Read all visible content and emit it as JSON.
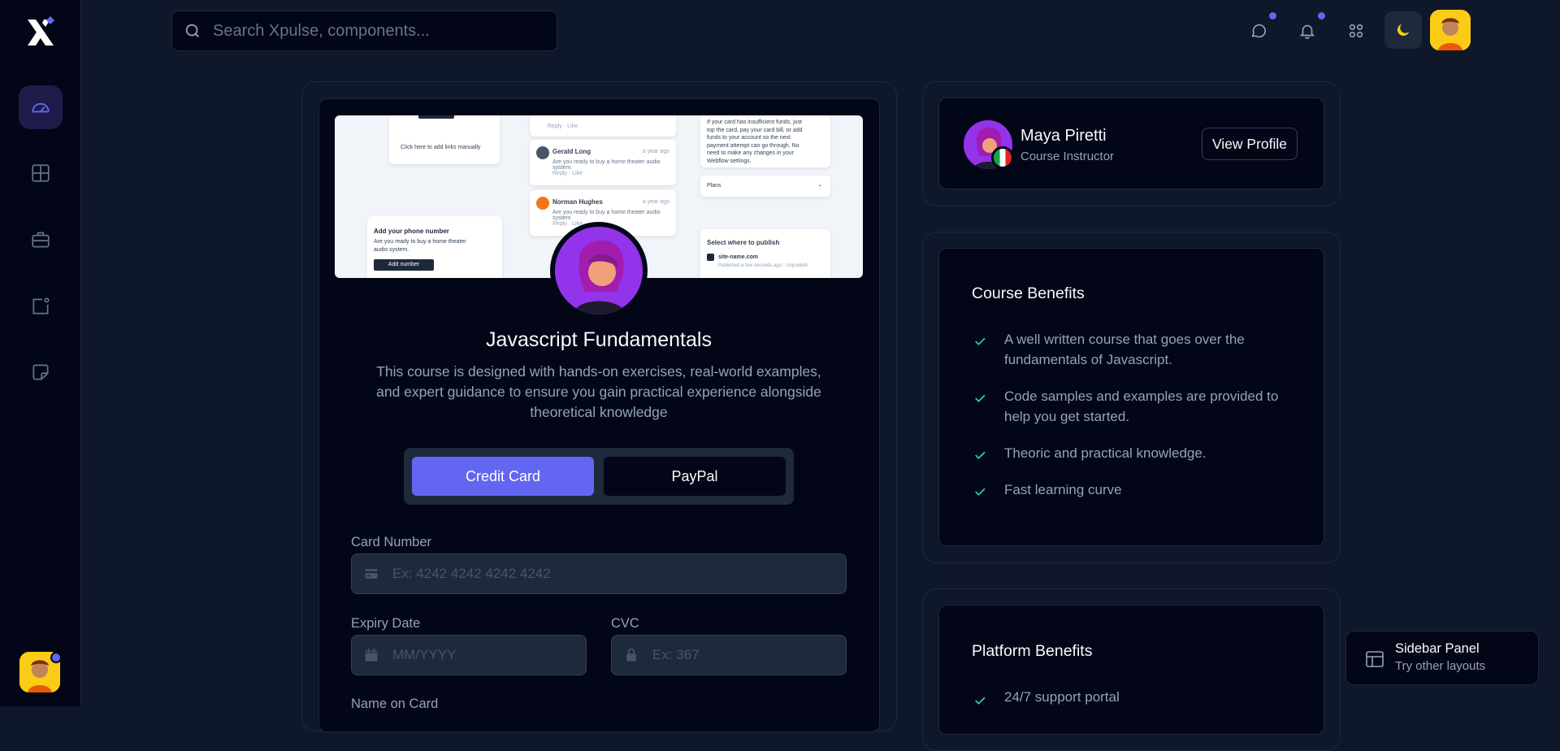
{
  "search": {
    "placeholder": "Search Xpulse, components..."
  },
  "sidebar": {
    "items": [
      "dashboard",
      "grid",
      "briefcase",
      "notification-square",
      "sticky-note"
    ]
  },
  "course": {
    "title": "Javascript Fundamentals",
    "description": "This course is designed with hands-on exercises, real-world examples, and expert guidance to ensure you gain practical experience alongside theoretical knowledge",
    "banner": {
      "add_links": "Click here to add links manually",
      "comment1_name": "Gerald Long",
      "comment1_time": "a year ago",
      "comment1_text": "Are you ready to buy a home theater audio system.",
      "comment2_name": "Norman Hughes",
      "comment2_time": "a year ago",
      "comment2_text": "Are you ready to buy a home theater audio system.",
      "reply_like": "Reply · Like",
      "funds_text": "If your card has insufficient funds, just top the card, pay your card bill, or add funds to your account so the next payment attempt can go through. No need to make any changes in your Webflow settings.",
      "plans_label": "Plans",
      "phone_title": "Add your phone number",
      "phone_text": "Are you ready to buy a home theater audio system.",
      "add_number": "Add number",
      "publish_title": "Select where to publish",
      "publish_site": "site-name.com",
      "publish_sub": "Published a few seconds ago · Unpublish"
    }
  },
  "payment": {
    "tabs": [
      "Credit Card",
      "PayPal"
    ],
    "active_tab": "Credit Card",
    "card_number_label": "Card Number",
    "card_number_placeholder": "Ex: 4242 4242 4242 4242",
    "expiry_label": "Expiry Date",
    "expiry_placeholder": "MM/YYYY",
    "cvc_label": "CVC",
    "cvc_placeholder": "Ex: 367",
    "name_label": "Name on Card"
  },
  "instructor": {
    "name": "Maya Piretti",
    "role": "Course Instructor",
    "button": "View Profile"
  },
  "course_benefits": {
    "title": "Course Benefits",
    "items": [
      "A well written course that goes over the fundamentals of Javascript.",
      "Code samples and examples are provided to help you get started.",
      "Theoric and practical knowledge.",
      "Fast learning curve"
    ]
  },
  "platform_benefits": {
    "title": "Platform Benefits",
    "items": [
      "24/7 support portal"
    ]
  },
  "sidebar_panel": {
    "title": "Sidebar Panel",
    "subtitle": "Try other layouts"
  },
  "colors": {
    "accent": "#6366f1",
    "check": "#2dd4bf",
    "background": "#0f172a",
    "card": "#020617"
  }
}
